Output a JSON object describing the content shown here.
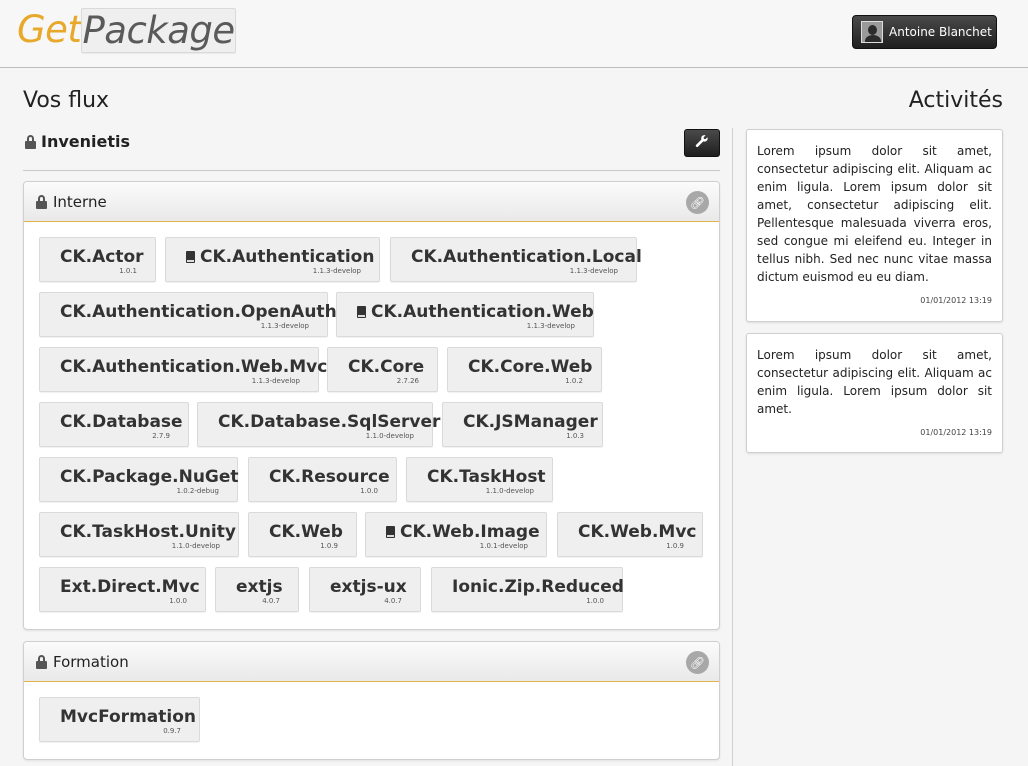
{
  "header": {
    "logo_part1": "Get",
    "logo_part2": "Package",
    "user_name": "Antoine Blanchet"
  },
  "left_heading": "Vos flux",
  "right_heading": "Activités",
  "feed": {
    "title": "Invenietis",
    "settings_icon": "wrench-icon"
  },
  "panels": [
    {
      "title": "Interne",
      "packages": [
        {
          "name": "CK.Actor",
          "version": "1.0.1",
          "book": false
        },
        {
          "name": "CK.Authentication",
          "version": "1.1.3-develop",
          "book": true
        },
        {
          "name": "CK.Authentication.Local",
          "version": "1.1.3-develop",
          "book": false
        },
        {
          "name": "CK.Authentication.OpenAuth",
          "version": "1.1.3-develop",
          "book": false
        },
        {
          "name": "CK.Authentication.Web",
          "version": "1.1.3-develop",
          "book": true
        },
        {
          "name": "CK.Authentication.Web.Mvc",
          "version": "1.1.3-develop",
          "book": false
        },
        {
          "name": "CK.Core",
          "version": "2.7.26",
          "book": false
        },
        {
          "name": "CK.Core.Web",
          "version": "1.0.2",
          "book": false
        },
        {
          "name": "CK.Database",
          "version": "2.7.9",
          "book": false
        },
        {
          "name": "CK.Database.SqlServer",
          "version": "1.1.0-develop",
          "book": false
        },
        {
          "name": "CK.JSManager",
          "version": "1.0.3",
          "book": false
        },
        {
          "name": "CK.Package.NuGet",
          "version": "1.0.2-debug",
          "book": false
        },
        {
          "name": "CK.Resource",
          "version": "1.0.0",
          "book": false
        },
        {
          "name": "CK.TaskHost",
          "version": "1.1.0-develop",
          "book": false
        },
        {
          "name": "CK.TaskHost.Unity",
          "version": "1.1.0-develop",
          "book": false
        },
        {
          "name": "CK.Web",
          "version": "1.0.9",
          "book": false
        },
        {
          "name": "CK.Web.Image",
          "version": "1.0.1-develop",
          "book": true
        },
        {
          "name": "CK.Web.Mvc",
          "version": "1.0.9",
          "book": false
        },
        {
          "name": "Ext.Direct.Mvc",
          "version": "1.0.0",
          "book": false
        },
        {
          "name": "extjs",
          "version": "4.0.7",
          "book": false
        },
        {
          "name": "extjs-ux",
          "version": "4.0.7",
          "book": false
        },
        {
          "name": "Ionic.Zip.Reduced",
          "version": "1.0.0",
          "book": false
        }
      ]
    },
    {
      "title": "Formation",
      "packages": [
        {
          "name": "MvcFormation",
          "version": "0.9.7",
          "book": false
        }
      ]
    }
  ],
  "activities": [
    {
      "text": "Lorem ipsum dolor sit amet, consectetur adipiscing elit. Aliquam ac enim ligula. Lorem ipsum dolor sit amet, consectetur adipiscing elit. Pellentesque malesuada viverra eros, sed congue mi eleifend eu. Integer in tellus nibh. Sed nec nunc vitae massa dictum euismod eu eu diam.",
      "date": "01/01/2012 13:19"
    },
    {
      "text": "Lorem ipsum dolor sit amet, consectetur adipiscing elit. Aliquam ac enim ligula. Lorem ipsum dolor sit amet.",
      "date": "01/01/2012 13:19"
    }
  ]
}
